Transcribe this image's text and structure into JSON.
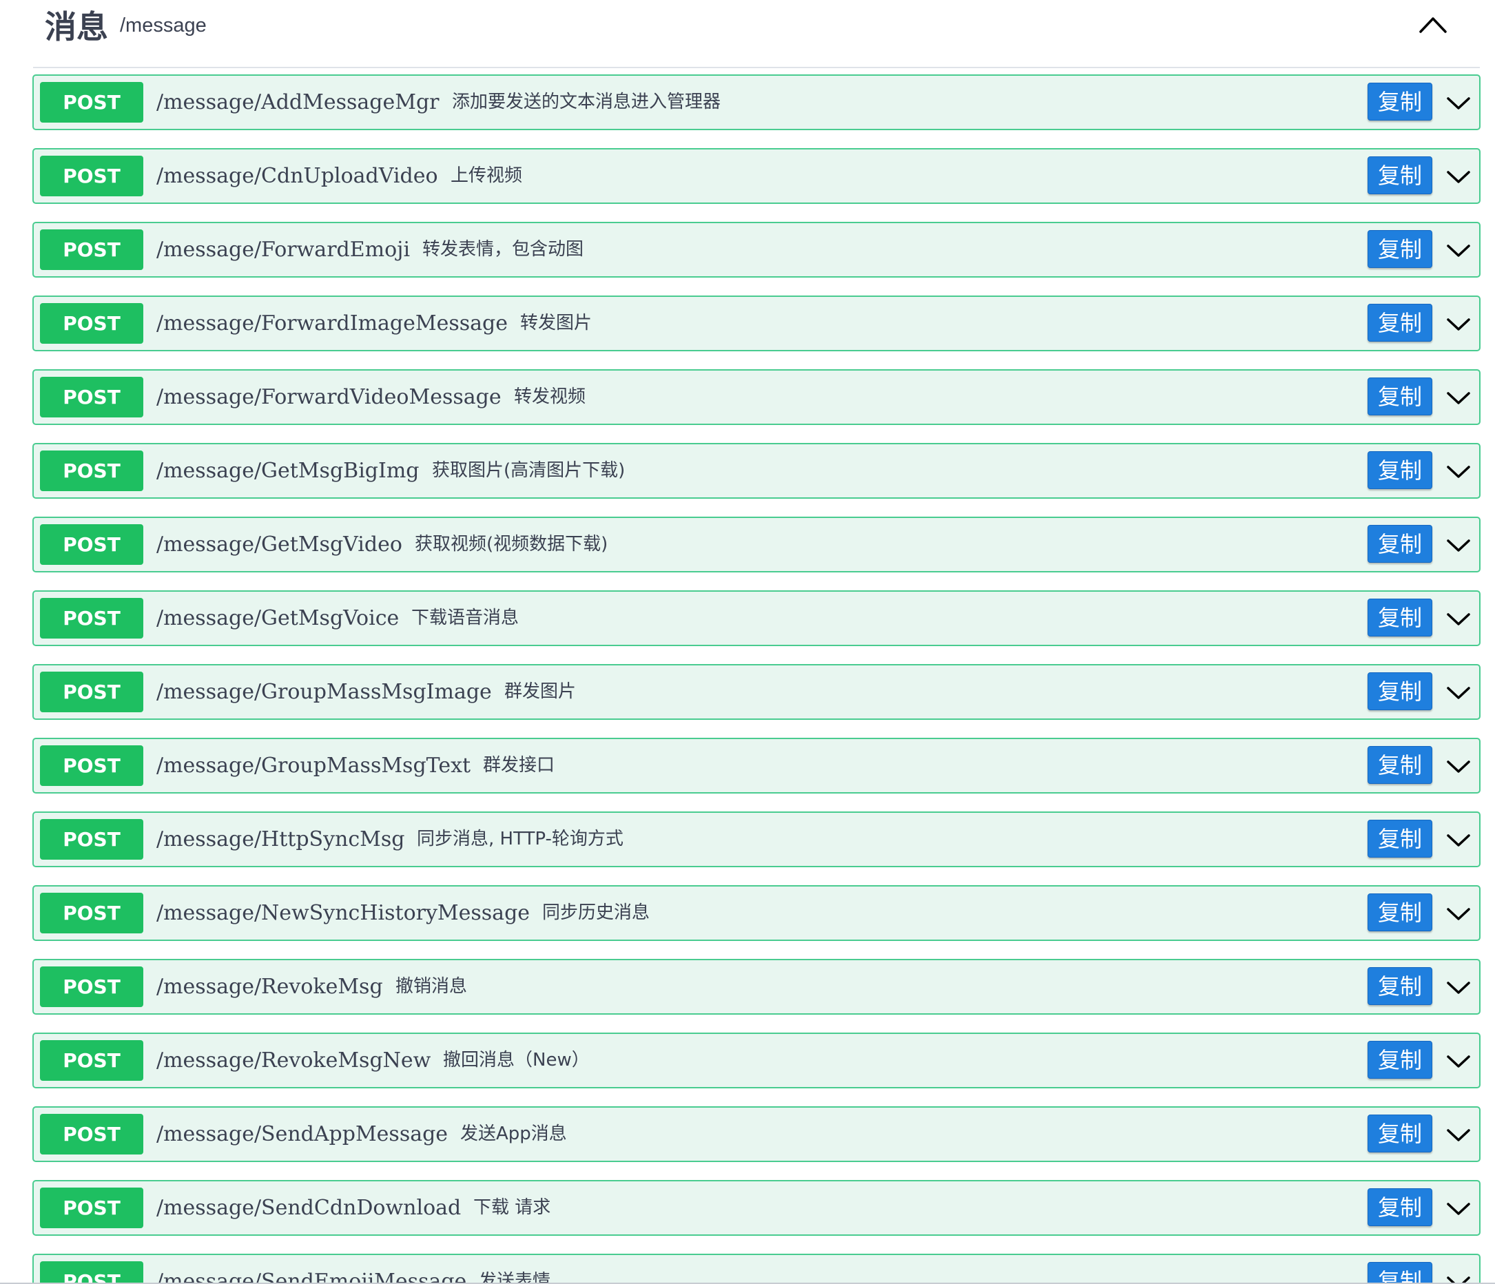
{
  "section": {
    "title": "消息",
    "path": "/message"
  },
  "copy_label": "复制",
  "operations": [
    {
      "method": "POST",
      "path": "/message/AddMessageMgr",
      "summary": "添加要发送的文本消息进入管理器"
    },
    {
      "method": "POST",
      "path": "/message/CdnUploadVideo",
      "summary": "上传视频"
    },
    {
      "method": "POST",
      "path": "/message/ForwardEmoji",
      "summary": "转发表情，包含动图"
    },
    {
      "method": "POST",
      "path": "/message/ForwardImageMessage",
      "summary": "转发图片"
    },
    {
      "method": "POST",
      "path": "/message/ForwardVideoMessage",
      "summary": "转发视频"
    },
    {
      "method": "POST",
      "path": "/message/GetMsgBigImg",
      "summary": "获取图片(高清图片下载)"
    },
    {
      "method": "POST",
      "path": "/message/GetMsgVideo",
      "summary": "获取视频(视频数据下载)"
    },
    {
      "method": "POST",
      "path": "/message/GetMsgVoice",
      "summary": "下载语音消息"
    },
    {
      "method": "POST",
      "path": "/message/GroupMassMsgImage",
      "summary": "群发图片"
    },
    {
      "method": "POST",
      "path": "/message/GroupMassMsgText",
      "summary": "群发接口"
    },
    {
      "method": "POST",
      "path": "/message/HttpSyncMsg",
      "summary": "同步消息, HTTP-轮询方式"
    },
    {
      "method": "POST",
      "path": "/message/NewSyncHistoryMessage",
      "summary": "同步历史消息"
    },
    {
      "method": "POST",
      "path": "/message/RevokeMsg",
      "summary": "撤销消息"
    },
    {
      "method": "POST",
      "path": "/message/RevokeMsgNew",
      "summary": "撤回消息（New）"
    },
    {
      "method": "POST",
      "path": "/message/SendAppMessage",
      "summary": "发送App消息"
    },
    {
      "method": "POST",
      "path": "/message/SendCdnDownload",
      "summary": "下载 请求"
    },
    {
      "method": "POST",
      "path": "/message/SendEmojiMessage",
      "summary": "发送表情"
    }
  ],
  "colors": {
    "post_badge": "#1ebf61",
    "post_border": "#49cc90",
    "post_background": "#e8f6f0",
    "copy_button": "#1f7fde",
    "text": "#3b4151"
  },
  "icons": {
    "collapse": "chevron-up-icon",
    "expand": "chevron-down-icon"
  }
}
